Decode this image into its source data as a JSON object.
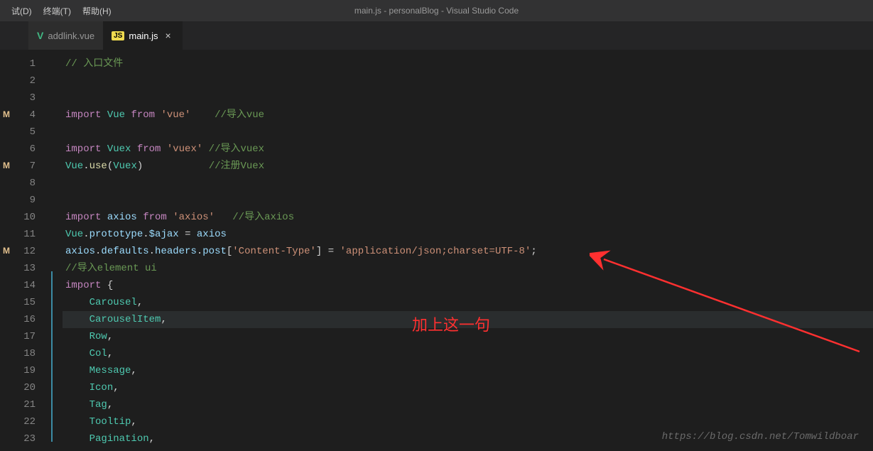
{
  "menubar": {
    "items": [
      "试(D)",
      "终端(T)",
      "帮助(H)"
    ],
    "title": "main.js - personalBlog - Visual Studio Code"
  },
  "tabs": [
    {
      "icon": "V",
      "label": "addlink.vue",
      "active": false,
      "closable": false
    },
    {
      "icon": "JS",
      "label": "main.js",
      "active": true,
      "closable": true
    }
  ],
  "git_markers": [
    {
      "line": 4,
      "marker": "M"
    },
    {
      "line": 7,
      "marker": "M"
    },
    {
      "line": 12,
      "marker": "M"
    }
  ],
  "code": {
    "lines": [
      {
        "n": 1,
        "tokens": [
          [
            "comment",
            "// 入口文件"
          ]
        ]
      },
      {
        "n": 2,
        "tokens": []
      },
      {
        "n": 3,
        "tokens": []
      },
      {
        "n": 4,
        "tokens": [
          [
            "keyword",
            "import "
          ],
          [
            "class",
            "Vue"
          ],
          [
            "keyword",
            " from "
          ],
          [
            "string",
            "'vue'"
          ],
          [
            "punct",
            "    "
          ],
          [
            "comment",
            "//导入vue"
          ]
        ]
      },
      {
        "n": 5,
        "tokens": []
      },
      {
        "n": 6,
        "tokens": [
          [
            "keyword",
            "import "
          ],
          [
            "class",
            "Vuex"
          ],
          [
            "keyword",
            " from "
          ],
          [
            "string",
            "'vuex'"
          ],
          [
            "punct",
            " "
          ],
          [
            "comment",
            "//导入vuex"
          ]
        ]
      },
      {
        "n": 7,
        "tokens": [
          [
            "class",
            "Vue"
          ],
          [
            "punct",
            "."
          ],
          [
            "func",
            "use"
          ],
          [
            "punct",
            "("
          ],
          [
            "class",
            "Vuex"
          ],
          [
            "punct",
            ")           "
          ],
          [
            "comment",
            "//注册Vuex"
          ]
        ]
      },
      {
        "n": 8,
        "tokens": []
      },
      {
        "n": 9,
        "tokens": []
      },
      {
        "n": 10,
        "tokens": [
          [
            "keyword",
            "import "
          ],
          [
            "var",
            "axios"
          ],
          [
            "keyword",
            " from "
          ],
          [
            "string",
            "'axios'"
          ],
          [
            "punct",
            "   "
          ],
          [
            "comment",
            "//导入axios"
          ]
        ]
      },
      {
        "n": 11,
        "tokens": [
          [
            "class",
            "Vue"
          ],
          [
            "punct",
            "."
          ],
          [
            "prop",
            "prototype"
          ],
          [
            "punct",
            "."
          ],
          [
            "var",
            "$ajax"
          ],
          [
            "punct",
            " = "
          ],
          [
            "var",
            "axios"
          ]
        ]
      },
      {
        "n": 12,
        "tokens": [
          [
            "var",
            "axios"
          ],
          [
            "punct",
            "."
          ],
          [
            "prop",
            "defaults"
          ],
          [
            "punct",
            "."
          ],
          [
            "prop",
            "headers"
          ],
          [
            "punct",
            "."
          ],
          [
            "prop",
            "post"
          ],
          [
            "punct",
            "["
          ],
          [
            "string",
            "'Content-Type'"
          ],
          [
            "punct",
            "] = "
          ],
          [
            "string",
            "'application/json;charset=UTF-8'"
          ],
          [
            "punct",
            ";"
          ]
        ]
      },
      {
        "n": 13,
        "tokens": [
          [
            "comment",
            "//导入element ui"
          ]
        ]
      },
      {
        "n": 14,
        "tokens": [
          [
            "keyword",
            "import"
          ],
          [
            "punct",
            " {"
          ]
        ]
      },
      {
        "n": 15,
        "tokens": [
          [
            "punct",
            "    "
          ],
          [
            "class",
            "Carousel"
          ],
          [
            "punct",
            ","
          ]
        ]
      },
      {
        "n": 16,
        "tokens": [
          [
            "punct",
            "    "
          ],
          [
            "class",
            "CarouselItem"
          ],
          [
            "punct",
            ","
          ]
        ],
        "current": true
      },
      {
        "n": 17,
        "tokens": [
          [
            "punct",
            "    "
          ],
          [
            "class",
            "Row"
          ],
          [
            "punct",
            ","
          ]
        ]
      },
      {
        "n": 18,
        "tokens": [
          [
            "punct",
            "    "
          ],
          [
            "class",
            "Col"
          ],
          [
            "punct",
            ","
          ]
        ]
      },
      {
        "n": 19,
        "tokens": [
          [
            "punct",
            "    "
          ],
          [
            "class",
            "Message"
          ],
          [
            "punct",
            ","
          ]
        ]
      },
      {
        "n": 20,
        "tokens": [
          [
            "punct",
            "    "
          ],
          [
            "class",
            "Icon"
          ],
          [
            "punct",
            ","
          ]
        ]
      },
      {
        "n": 21,
        "tokens": [
          [
            "punct",
            "    "
          ],
          [
            "class",
            "Tag"
          ],
          [
            "punct",
            ","
          ]
        ]
      },
      {
        "n": 22,
        "tokens": [
          [
            "punct",
            "    "
          ],
          [
            "class",
            "Tooltip"
          ],
          [
            "punct",
            ","
          ]
        ]
      },
      {
        "n": 23,
        "tokens": [
          [
            "punct",
            "    "
          ],
          [
            "class",
            "Pagination"
          ],
          [
            "punct",
            ","
          ]
        ]
      }
    ]
  },
  "annotation": "加上这一句",
  "watermark": "https://blog.csdn.net/Tomwildboar"
}
